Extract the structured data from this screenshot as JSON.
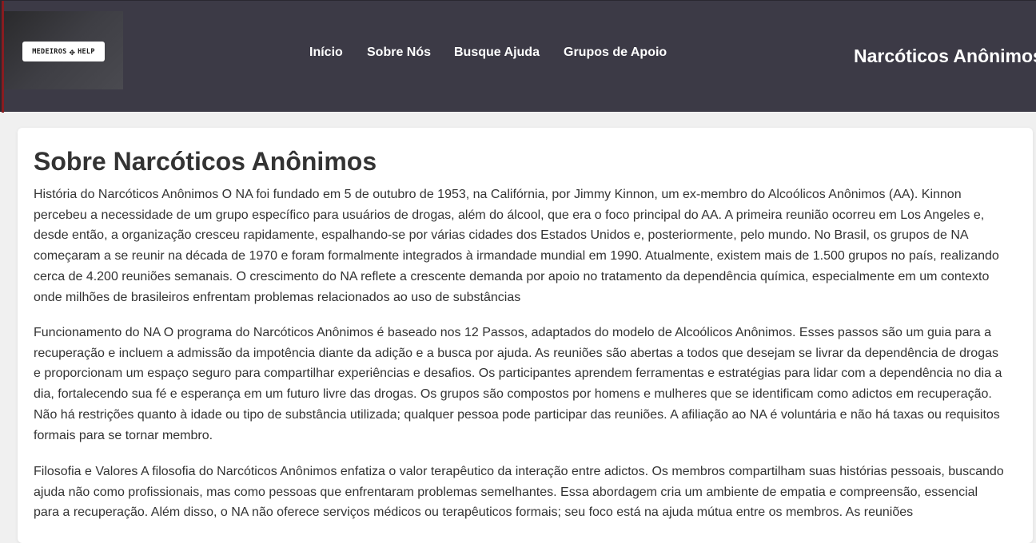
{
  "header": {
    "logo_text_left": "MEDEIROS",
    "logo_text_right": "HELP",
    "nav": [
      {
        "label": "Início"
      },
      {
        "label": "Sobre Nós"
      },
      {
        "label": "Busque Ajuda"
      },
      {
        "label": "Grupos de Apoio"
      }
    ],
    "brand_title": "Narcóticos Anônimos"
  },
  "main": {
    "title": "Sobre Narcóticos Anônimos",
    "paragraphs": [
      "História do Narcóticos Anônimos O NA foi fundado em 5 de outubro de 1953, na Califórnia, por Jimmy Kinnon, um ex-membro do Alcoólicos Anônimos (AA). Kinnon percebeu a necessidade de um grupo específico para usuários de drogas, além do álcool, que era o foco principal do AA. A primeira reunião ocorreu em Los Angeles e, desde então, a organização cresceu rapidamente, espalhando-se por várias cidades dos Estados Unidos e, posteriormente, pelo mundo. No Brasil, os grupos de NA começaram a se reunir na década de 1970 e foram formalmente integrados à irmandade mundial em 1990. Atualmente, existem mais de 1.500 grupos no país, realizando cerca de 4.200 reuniões semanais. O crescimento do NA reflete a crescente demanda por apoio no tratamento da dependência química, especialmente em um contexto onde milhões de brasileiros enfrentam problemas relacionados ao uso de substâncias",
      "Funcionamento do NA O programa do Narcóticos Anônimos é baseado nos 12 Passos, adaptados do modelo de Alcoólicos Anônimos. Esses passos são um guia para a recuperação e incluem a admissão da impotência diante da adição e a busca por ajuda. As reuniões são abertas a todos que desejam se livrar da dependência de drogas e proporcionam um espaço seguro para compartilhar experiências e desafios. Os participantes aprendem ferramentas e estratégias para lidar com a dependência no dia a dia, fortalecendo sua fé e esperança em um futuro livre das drogas. Os grupos são compostos por homens e mulheres que se identificam como adictos em recuperação. Não há restrições quanto à idade ou tipo de substância utilizada; qualquer pessoa pode participar das reuniões. A afiliação ao NA é voluntária e não há taxas ou requisitos formais para se tornar membro.",
      "Filosofia e Valores A filosofia do Narcóticos Anônimos enfatiza o valor terapêutico da interação entre adictos. Os membros compartilham suas histórias pessoais, buscando ajuda não como profissionais, mas como pessoas que enfrentaram problemas semelhantes. Essa abordagem cria um ambiente de empatia e compreensão, essencial para a recuperação. Além disso, o NA não oferece serviços médicos ou terapêuticos formais; seu foco está na ajuda mútua entre os membros. As reuniões"
    ]
  }
}
